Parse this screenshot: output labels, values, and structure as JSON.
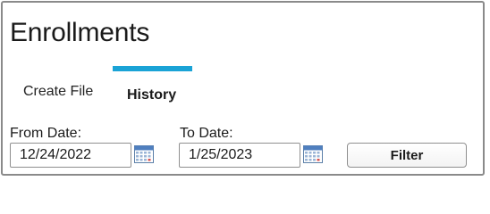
{
  "panel": {
    "title": "Enrollments"
  },
  "tabs": [
    {
      "label": "Create File",
      "active": false
    },
    {
      "label": "History",
      "active": true
    }
  ],
  "accent_color": "#1aa3d6",
  "filters": {
    "from_label": "From Date:",
    "from_value": "12/24/2022",
    "to_label": "To Date:",
    "to_value": "1/25/2023",
    "calendar_icon": "calendar-icon",
    "filter_button_label": "Filter"
  }
}
